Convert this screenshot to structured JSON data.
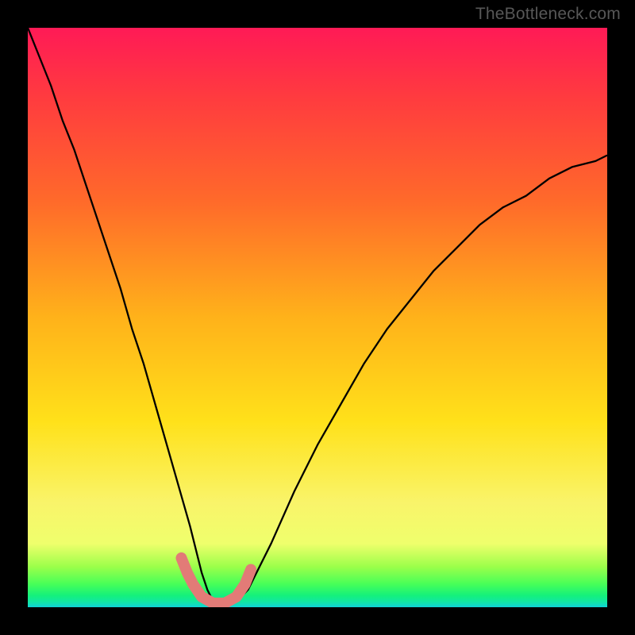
{
  "watermark": "TheBottleneck.com",
  "chart_data": {
    "type": "line",
    "title": "",
    "xlabel": "",
    "ylabel": "",
    "x_range": [
      0,
      100
    ],
    "y_range": [
      0,
      100
    ],
    "series": [
      {
        "name": "bottleneck-curve",
        "x": [
          0,
          2,
          4,
          6,
          8,
          10,
          12,
          14,
          16,
          18,
          20,
          22,
          24,
          26,
          28,
          30,
          31,
          32,
          33,
          34,
          36,
          38,
          40,
          42,
          46,
          50,
          54,
          58,
          62,
          66,
          70,
          74,
          78,
          82,
          86,
          90,
          94,
          98,
          100
        ],
        "y_pct": [
          100,
          95,
          90,
          84,
          79,
          73,
          67,
          61,
          55,
          48,
          42,
          35,
          28,
          21,
          14,
          6,
          3,
          1,
          0,
          0,
          1,
          3,
          7,
          11,
          20,
          28,
          35,
          42,
          48,
          53,
          58,
          62,
          66,
          69,
          71,
          74,
          76,
          77,
          78
        ]
      },
      {
        "name": "trough-marker-curve",
        "x": [
          26.5,
          27.5,
          28.5,
          30.0,
          32.0,
          34.0,
          36.0,
          37.5,
          38.5
        ],
        "y_pct": [
          8.5,
          6.0,
          4.0,
          1.8,
          0.7,
          0.7,
          1.8,
          4.0,
          6.5
        ]
      }
    ],
    "gradient_stops": [
      {
        "pos": 0,
        "color": "#ff1a56"
      },
      {
        "pos": 12,
        "color": "#ff3b3f"
      },
      {
        "pos": 30,
        "color": "#ff6a2a"
      },
      {
        "pos": 50,
        "color": "#ffb21a"
      },
      {
        "pos": 68,
        "color": "#ffe11a"
      },
      {
        "pos": 82,
        "color": "#f9f46a"
      },
      {
        "pos": 89,
        "color": "#efff6c"
      },
      {
        "pos": 93,
        "color": "#9cff4a"
      },
      {
        "pos": 96,
        "color": "#47ff58"
      },
      {
        "pos": 98,
        "color": "#14f07c"
      },
      {
        "pos": 99,
        "color": "#12e8a0"
      },
      {
        "pos": 100,
        "color": "#10d2d6"
      }
    ],
    "colors": {
      "curve": "#000000",
      "trough_marker": "#e27b77",
      "background_frame": "#000000"
    }
  }
}
